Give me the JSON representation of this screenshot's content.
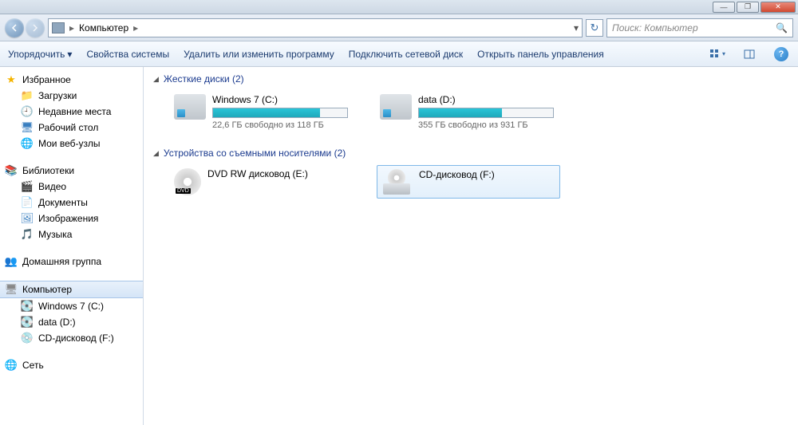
{
  "window": {
    "minimize": "—",
    "maximize": "❐",
    "close": "✕"
  },
  "addr": {
    "root": "Компьютер",
    "dropdown": "▾",
    "refresh": "↻",
    "search_placeholder": "Поиск: Компьютер",
    "search_icon": "🔍"
  },
  "toolbar": {
    "organize": "Упорядочить",
    "organize_arrow": "▾",
    "properties": "Свойства системы",
    "uninstall": "Удалить или изменить программу",
    "map_drive": "Подключить сетевой диск",
    "control_panel": "Открыть панель управления",
    "view_arrow": "▾"
  },
  "sidebar": {
    "favorites": "Избранное",
    "downloads": "Загрузки",
    "recent": "Недавние места",
    "desktop": "Рабочий стол",
    "websites": "Мои веб-узлы",
    "libraries": "Библиотеки",
    "video": "Видео",
    "documents": "Документы",
    "pictures": "Изображения",
    "music": "Музыка",
    "homegroup": "Домашняя группа",
    "computer": "Компьютер",
    "drive_c": "Windows 7 (C:)",
    "drive_d": "data (D:)",
    "drive_f": "CD-дисковод (F:)",
    "network": "Сеть"
  },
  "sections": {
    "hdd": "Жесткие диски (2)",
    "removable": "Устройства со съемными носителями (2)"
  },
  "drives": {
    "c": {
      "name": "Windows 7 (C:)",
      "free": "22,6 ГБ свободно из 118 ГБ",
      "fill_pct": 80
    },
    "d": {
      "name": "data (D:)",
      "free": "355 ГБ свободно из 931 ГБ",
      "fill_pct": 62
    },
    "e": {
      "name": "DVD RW дисковод (E:)"
    },
    "f": {
      "name": "CD-дисковод (F:)"
    }
  }
}
